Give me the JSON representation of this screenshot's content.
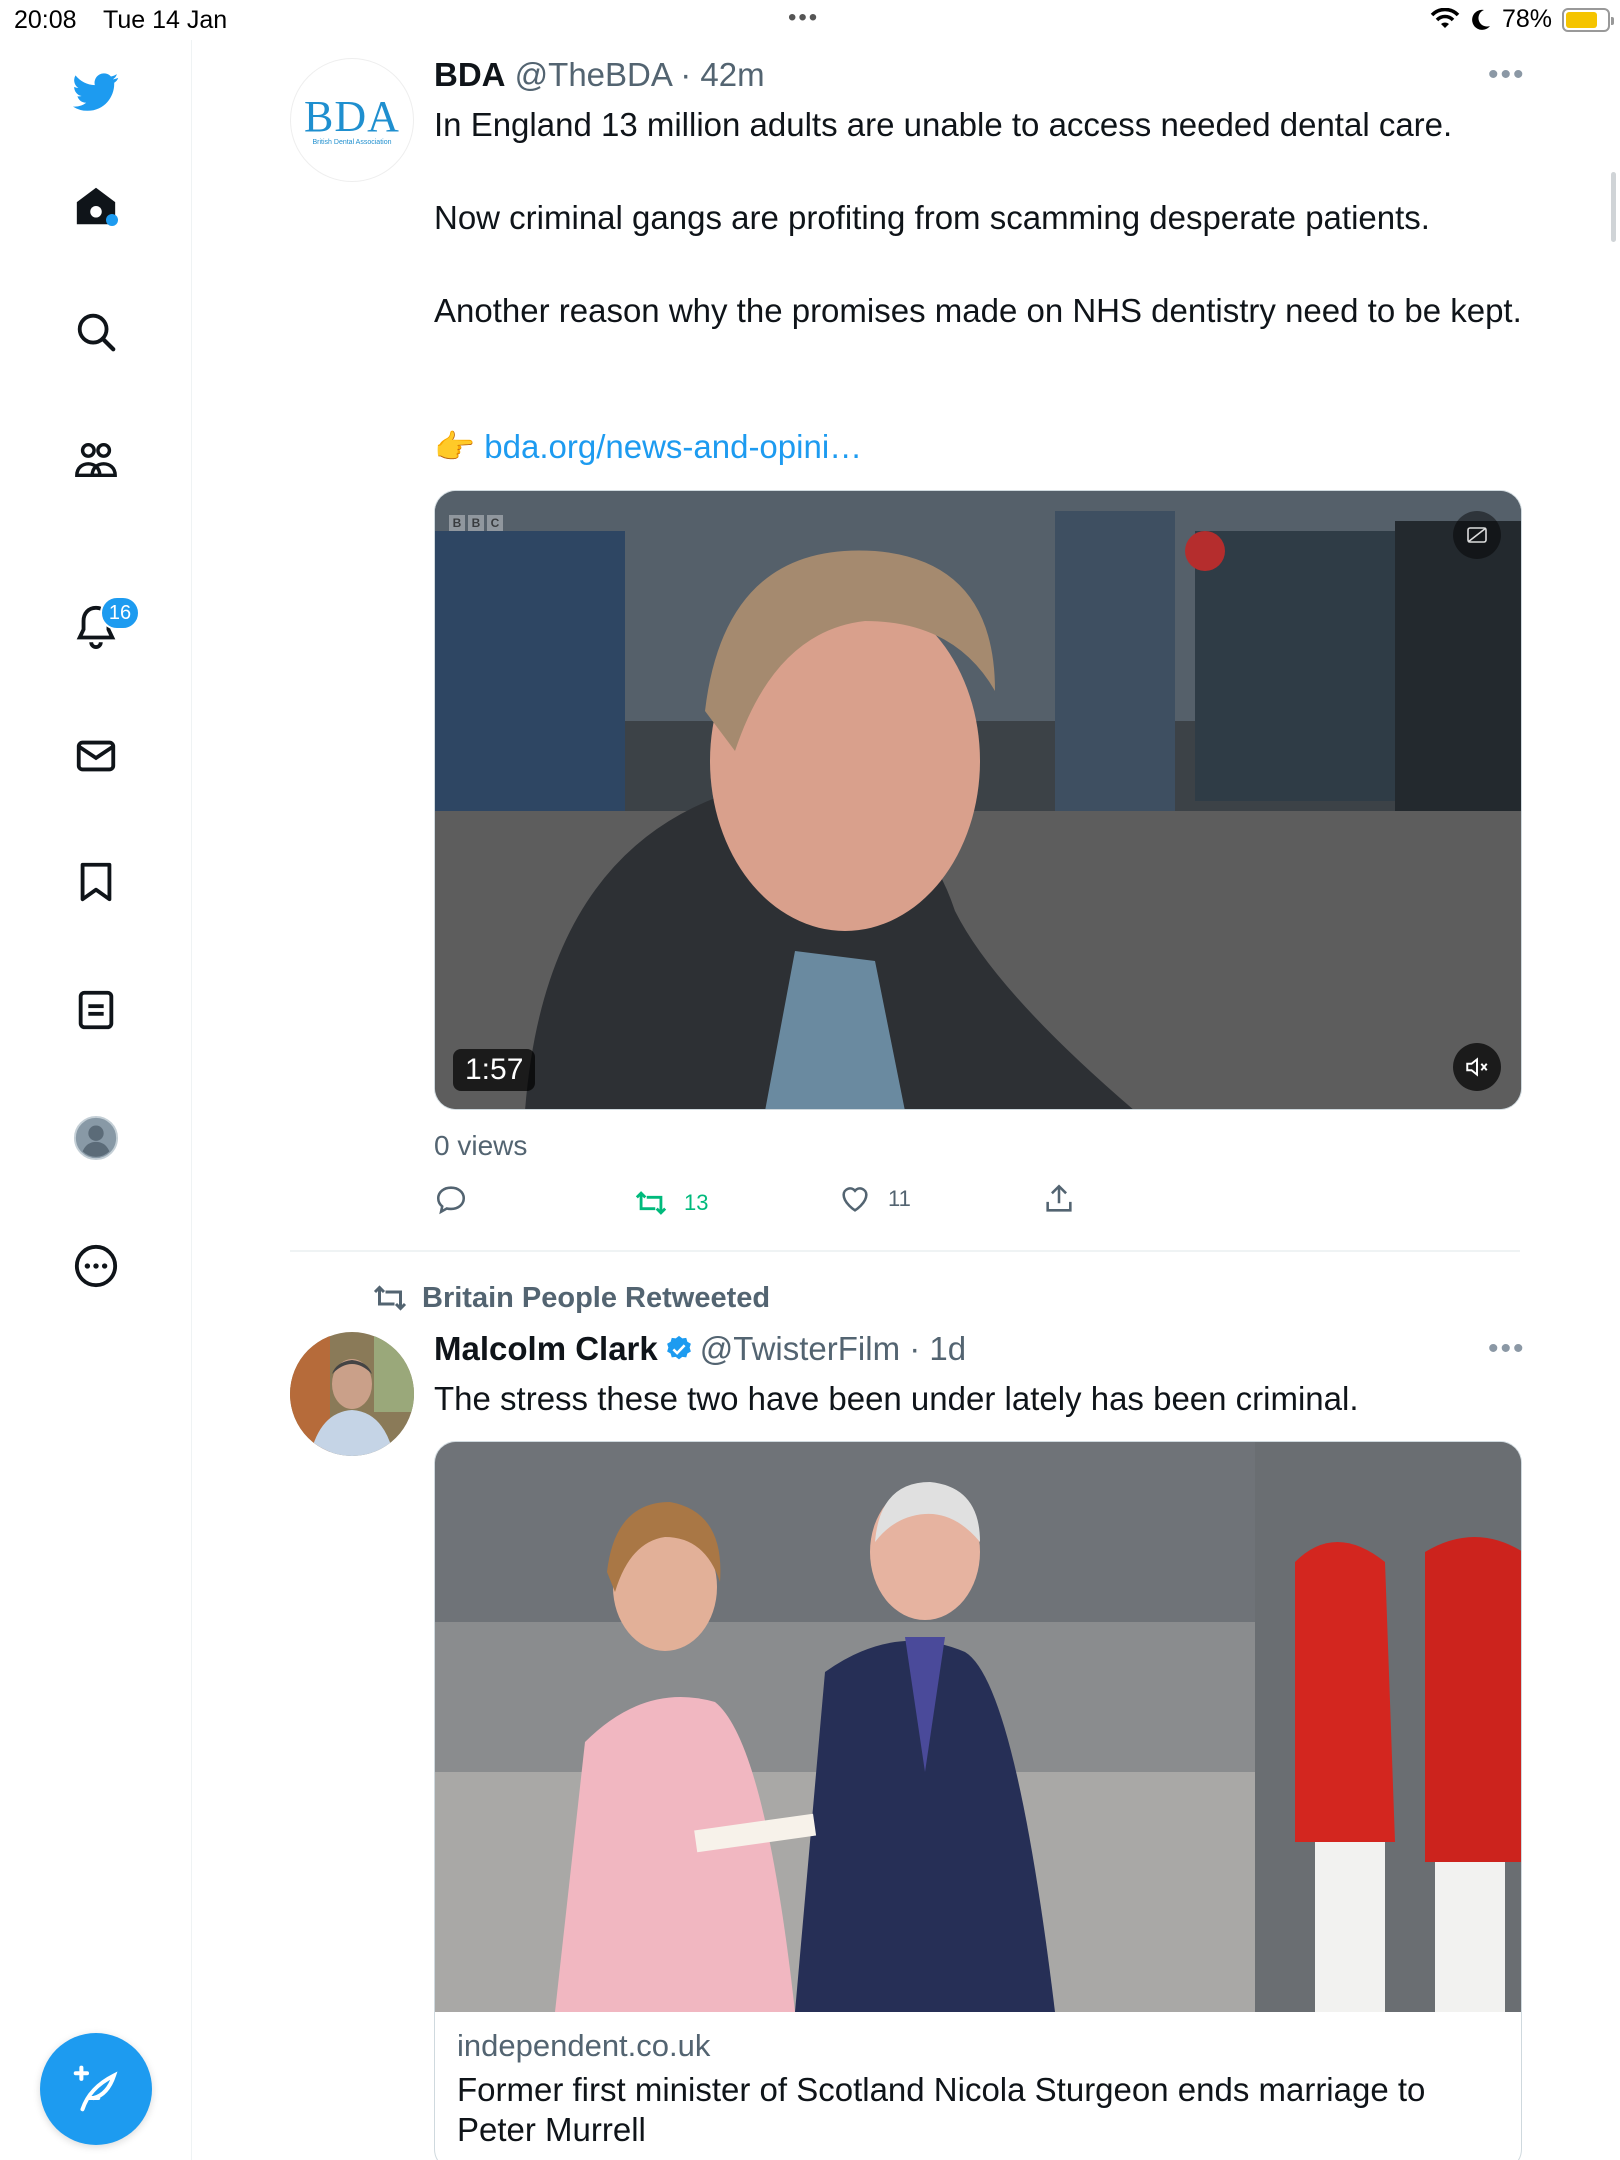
{
  "status_bar": {
    "time": "20:08",
    "date": "Tue 14 Jan",
    "battery": "78%",
    "battery_level": 0.78
  },
  "sidebar": {
    "items": [
      {
        "name": "twitter-logo-icon"
      },
      {
        "name": "home-icon",
        "has_new": true
      },
      {
        "name": "search-icon"
      },
      {
        "name": "communities-icon"
      },
      {
        "name": "notifications-icon",
        "badge": "16"
      },
      {
        "name": "messages-icon"
      },
      {
        "name": "bookmarks-icon"
      },
      {
        "name": "lists-icon"
      },
      {
        "name": "profile-icon"
      },
      {
        "name": "more-icon"
      }
    ],
    "compose_label": "+"
  },
  "tweets": [
    {
      "avatar_text": "BDA",
      "avatar_subtext": "British Dental Association",
      "name": "BDA",
      "handle": "@TheBDA",
      "time": "· 42m",
      "text_lines": [
        "In England 13 million adults are unable to access needed dental care.",
        "Now criminal gangs are profiting from scamming desperate patients.",
        "Another reason why the promises made on NHS dentistry need to be kept."
      ],
      "link_emoji": "👉",
      "link": "bda.org/news-and-opini…",
      "video": {
        "duration": "1:57",
        "watermark": [
          "B",
          "B",
          "C"
        ]
      },
      "views": "0 views",
      "actions": {
        "reply": "",
        "retweets": "13",
        "likes": "11",
        "share": ""
      }
    },
    {
      "retweeted_by": "Britain People Retweeted",
      "name": "Malcolm Clark",
      "handle": "@TwisterFilm",
      "time": "· 1d",
      "verified": true,
      "text": "The stress these two have been under lately has been criminal.",
      "card": {
        "domain": "independent.co.uk",
        "title": "Former first minister of Scotland Nicola Sturgeon ends marriage to Peter Murrell"
      }
    }
  ],
  "colors": {
    "accent": "#1d9bf0",
    "retweet_green": "#00ba7c",
    "secondary_text": "#536471"
  }
}
